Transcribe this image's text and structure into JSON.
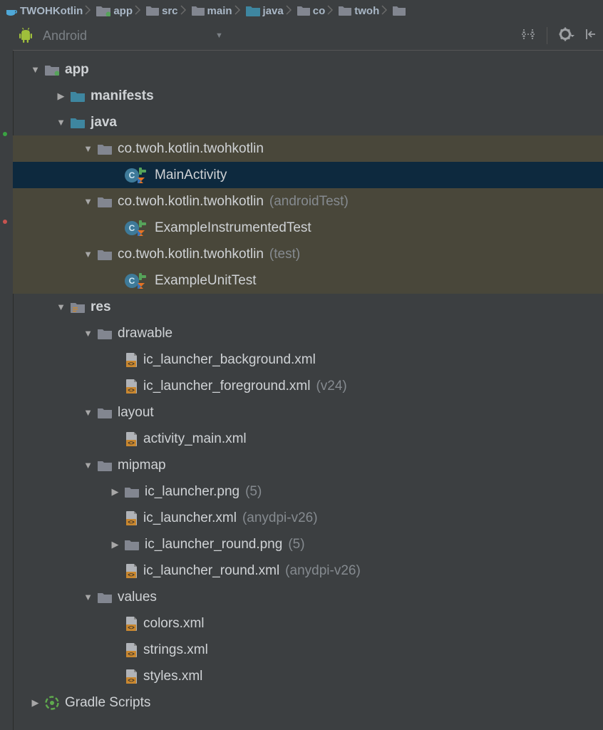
{
  "breadcrumb": [
    {
      "name": "TWOHKotlin",
      "icon": "cup"
    },
    {
      "name": "app",
      "icon": "module"
    },
    {
      "name": "src",
      "icon": "folder"
    },
    {
      "name": "main",
      "icon": "folder"
    },
    {
      "name": "java",
      "icon": "java-folder"
    },
    {
      "name": "co",
      "icon": "folder"
    },
    {
      "name": "twoh",
      "icon": "folder"
    },
    {
      "name": "",
      "icon": "folder"
    }
  ],
  "toolbar": {
    "label": "Android"
  },
  "tree": [
    {
      "d": 0,
      "arrow": "down",
      "icon": "module",
      "name": "app",
      "bold": true
    },
    {
      "d": 1,
      "arrow": "right",
      "icon": "blue-folder",
      "name": "manifests",
      "bold": true
    },
    {
      "d": 1,
      "arrow": "down",
      "icon": "blue-folder",
      "name": "java",
      "bold": true
    },
    {
      "d": 2,
      "arrow": "down",
      "icon": "package",
      "name": "co.twoh.kotlin.twohkotlin",
      "test": true
    },
    {
      "d": 3,
      "arrow": "",
      "icon": "kotlin-class",
      "name": "MainActivity",
      "selected": true
    },
    {
      "d": 2,
      "arrow": "down",
      "icon": "package",
      "name": "co.twoh.kotlin.twohkotlin",
      "suffix": "(androidTest)",
      "test": true
    },
    {
      "d": 3,
      "arrow": "",
      "icon": "kotlin-class",
      "name": "ExampleInstrumentedTest",
      "test": true
    },
    {
      "d": 2,
      "arrow": "down",
      "icon": "package",
      "name": "co.twoh.kotlin.twohkotlin",
      "suffix": "(test)",
      "test": true
    },
    {
      "d": 3,
      "arrow": "",
      "icon": "kotlin-class",
      "name": "ExampleUnitTest",
      "test": true
    },
    {
      "d": 1,
      "arrow": "down",
      "icon": "res-folder",
      "name": "res",
      "bold": true
    },
    {
      "d": 2,
      "arrow": "down",
      "icon": "package",
      "name": "drawable"
    },
    {
      "d": 3,
      "arrow": "",
      "icon": "xml",
      "name": "ic_launcher_background.xml"
    },
    {
      "d": 3,
      "arrow": "",
      "icon": "xml",
      "name": "ic_launcher_foreground.xml",
      "suffix": "(v24)"
    },
    {
      "d": 2,
      "arrow": "down",
      "icon": "package",
      "name": "layout"
    },
    {
      "d": 3,
      "arrow": "",
      "icon": "xml",
      "name": "activity_main.xml"
    },
    {
      "d": 2,
      "arrow": "down",
      "icon": "package",
      "name": "mipmap"
    },
    {
      "d": 3,
      "arrow": "right",
      "icon": "package",
      "name": "ic_launcher.png",
      "suffix": "(5)"
    },
    {
      "d": 3,
      "arrow": "",
      "icon": "xml",
      "name": "ic_launcher.xml",
      "suffix": "(anydpi-v26)"
    },
    {
      "d": 3,
      "arrow": "right",
      "icon": "package",
      "name": "ic_launcher_round.png",
      "suffix": "(5)"
    },
    {
      "d": 3,
      "arrow": "",
      "icon": "xml",
      "name": "ic_launcher_round.xml",
      "suffix": "(anydpi-v26)"
    },
    {
      "d": 2,
      "arrow": "down",
      "icon": "package",
      "name": "values"
    },
    {
      "d": 3,
      "arrow": "",
      "icon": "xml",
      "name": "colors.xml"
    },
    {
      "d": 3,
      "arrow": "",
      "icon": "xml",
      "name": "strings.xml"
    },
    {
      "d": 3,
      "arrow": "",
      "icon": "xml",
      "name": "styles.xml"
    },
    {
      "d": 0,
      "arrow": "right",
      "icon": "gradle",
      "name": "Gradle Scripts"
    }
  ]
}
